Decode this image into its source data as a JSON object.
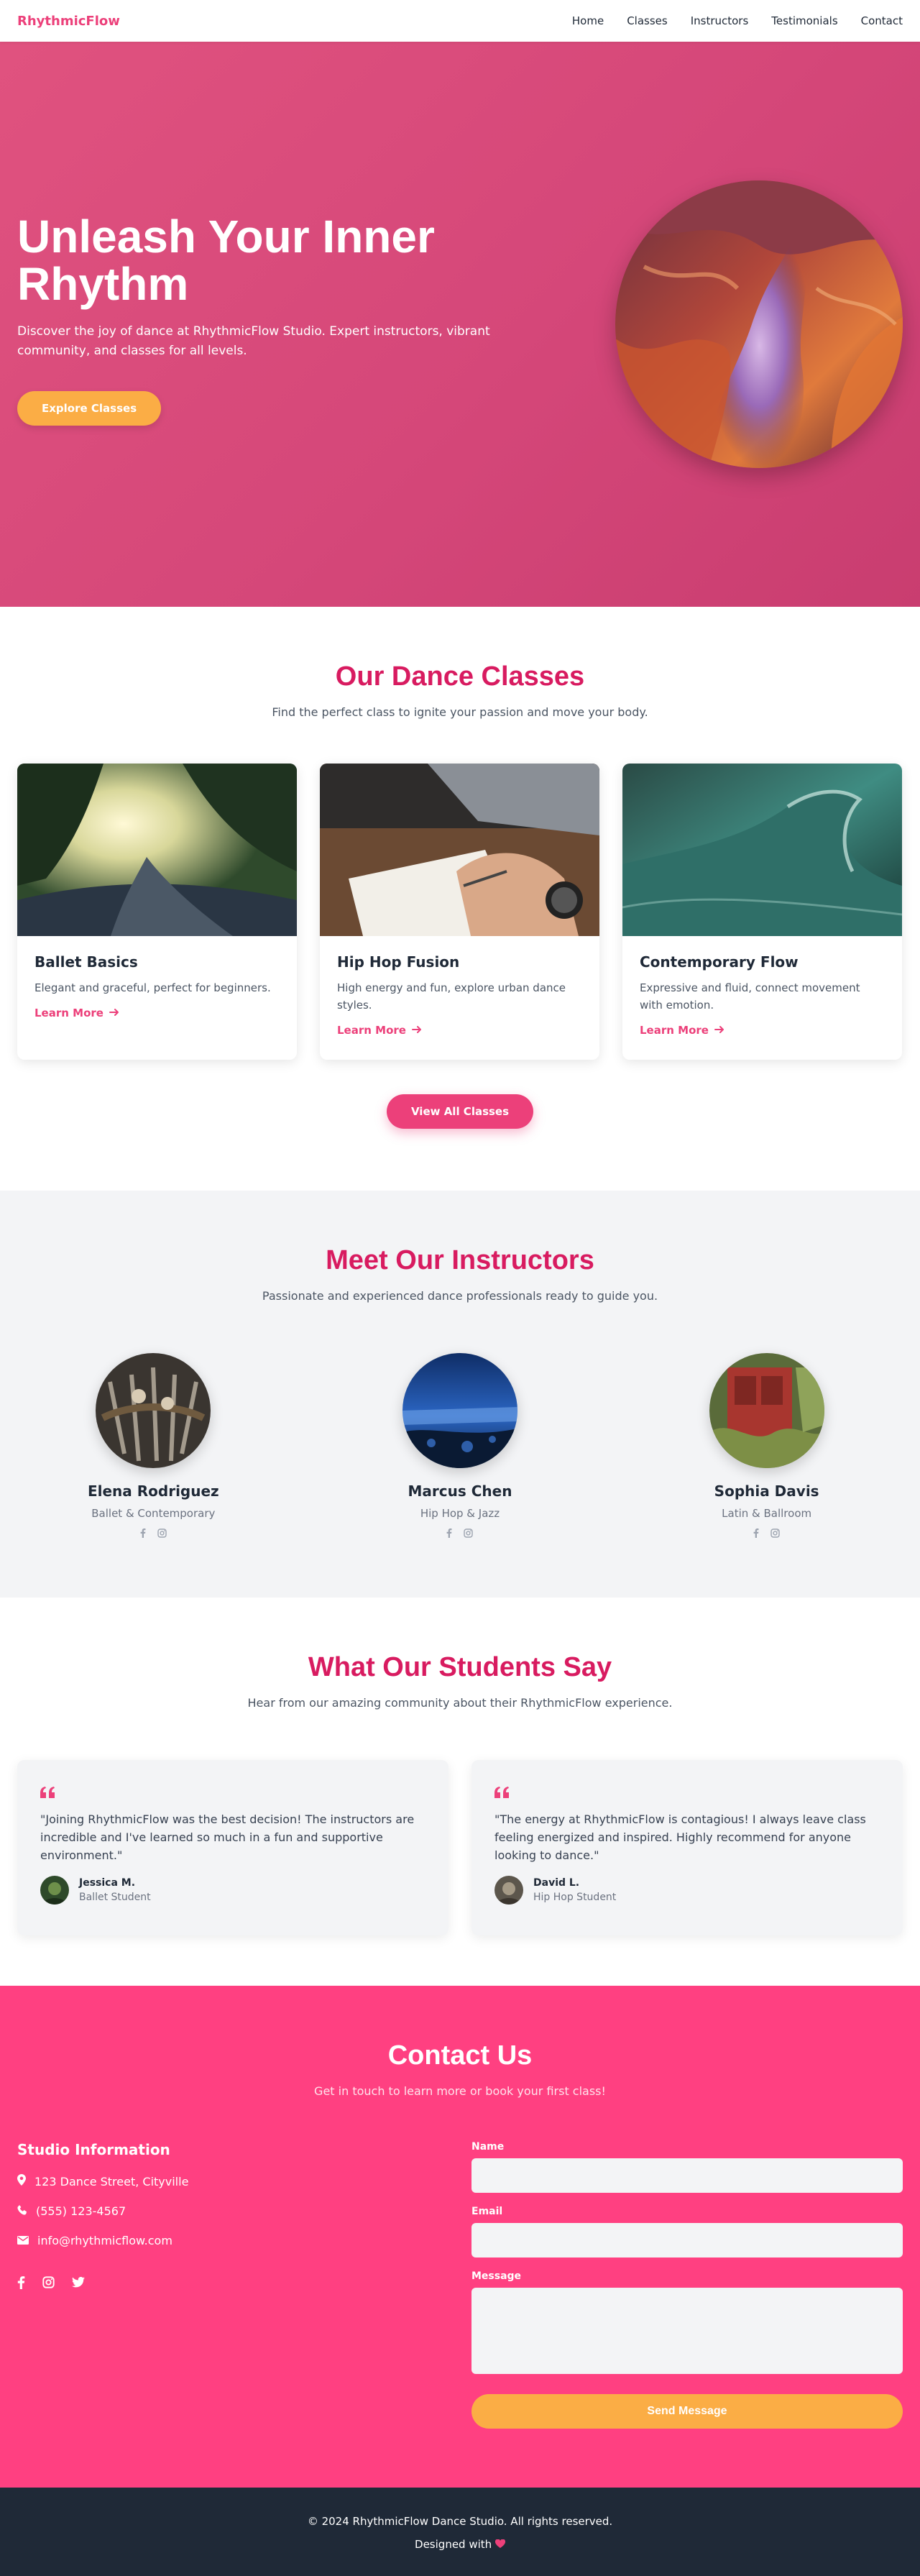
{
  "nav": {
    "brand": "RhythmicFlow",
    "links": [
      "Home",
      "Classes",
      "Instructors",
      "Testimonials",
      "Contact"
    ]
  },
  "hero": {
    "title_line1": "Unleash Your Inner",
    "title_line2": "Rhythm",
    "subtitle": "Discover the joy of dance at RhythmicFlow Studio. Expert instructors, vibrant community, and classes for all levels.",
    "cta": "Explore Classes"
  },
  "classes": {
    "title": "Our Dance Classes",
    "subtitle": "Find the perfect class to ignite your passion and move your body.",
    "items": [
      {
        "title": "Ballet Basics",
        "desc": "Elegant and graceful, perfect for beginners.",
        "link": "Learn More"
      },
      {
        "title": "Hip Hop Fusion",
        "desc": "High energy and fun, explore urban dance styles.",
        "link": "Learn More"
      },
      {
        "title": "Contemporary Flow",
        "desc": "Expressive and fluid, connect movement with emotion.",
        "link": "Learn More"
      }
    ],
    "view_all": "View All Classes"
  },
  "instructors": {
    "title": "Meet Our Instructors",
    "subtitle": "Passionate and experienced dance professionals ready to guide you.",
    "items": [
      {
        "name": "Elena Rodriguez",
        "role": "Ballet & Contemporary"
      },
      {
        "name": "Marcus Chen",
        "role": "Hip Hop & Jazz"
      },
      {
        "name": "Sophia Davis",
        "role": "Latin & Ballroom"
      }
    ]
  },
  "testimonials": {
    "title": "What Our Students Say",
    "subtitle": "Hear from our amazing community about their RhythmicFlow experience.",
    "items": [
      {
        "quote": "\"Joining RhythmicFlow was the best decision! The instructors are incredible and I've learned so much in a fun and supportive environment.\"",
        "name": "Jessica M.",
        "role": "Ballet Student"
      },
      {
        "quote": "\"The energy at RhythmicFlow is contagious! I always leave class feeling energized and inspired. Highly recommend for anyone looking to dance.\"",
        "name": "David L.",
        "role": "Hip Hop Student"
      }
    ]
  },
  "contact": {
    "title": "Contact Us",
    "subtitle": "Get in touch to learn more or book your first class!",
    "info_title": "Studio Information",
    "address": "123 Dance Street, Cityville",
    "phone": "(555) 123-4567",
    "email": "info@rhythmicflow.com",
    "form": {
      "name_label": "Name",
      "email_label": "Email",
      "message_label": "Message",
      "submit": "Send Message"
    }
  },
  "footer": {
    "copyright": "© 2024 RhythmicFlow Dance Studio. All rights reserved.",
    "designed": "Designed with"
  },
  "colors": {
    "brand_pink": "#ec407a",
    "hero_pink": "#d54779",
    "title_pink": "#d81b60",
    "contact_bg": "#ff4081",
    "amber": "#fbad45",
    "footer_bg": "#1f2937"
  },
  "icons": [
    "quote-icon",
    "map-pin-icon",
    "phone-icon",
    "mail-icon",
    "facebook-icon",
    "instagram-icon",
    "twitter-icon",
    "arrow-right-icon",
    "heart-icon"
  ]
}
